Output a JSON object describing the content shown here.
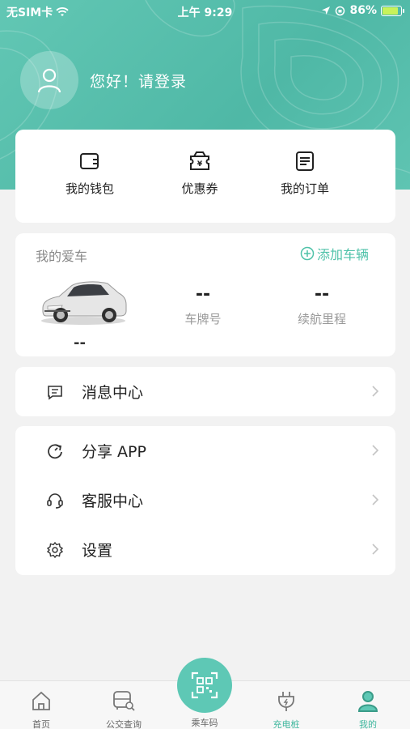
{
  "status_bar": {
    "carrier": "无SIM卡",
    "time": "上午 9:29",
    "battery": "86%"
  },
  "profile": {
    "greeting": "您好！请登录"
  },
  "quick_actions": [
    {
      "label": "我的钱包",
      "icon": "wallet-icon"
    },
    {
      "label": "优惠券",
      "icon": "coupon-icon"
    },
    {
      "label": "我的订单",
      "icon": "order-icon"
    }
  ],
  "my_car": {
    "title": "我的爱车",
    "add_label": "添加车辆",
    "car_name": "--",
    "plate_value": "--",
    "plate_label": "车牌号",
    "range_value": "--",
    "range_label": "续航里程"
  },
  "menu_group_1": [
    {
      "label": "消息中心",
      "icon": "message-icon"
    }
  ],
  "menu_group_2": [
    {
      "label": "分享 APP",
      "icon": "share-icon"
    },
    {
      "label": "客服中心",
      "icon": "headset-icon"
    },
    {
      "label": "设置",
      "icon": "gear-icon"
    }
  ],
  "tabbar": {
    "tabs": [
      {
        "label": "首页",
        "icon": "home-icon"
      },
      {
        "label": "公交查询",
        "icon": "bus-icon"
      },
      {
        "label": "乘车码",
        "icon": "qrcode-icon"
      },
      {
        "label": "充电桩",
        "icon": "plug-icon"
      },
      {
        "label": "我的",
        "icon": "user-icon"
      }
    ],
    "active_index": 4
  },
  "colors": {
    "accent": "#4fc2a9",
    "header": "#5bc3b0",
    "active_tab": "#3fb79e"
  }
}
